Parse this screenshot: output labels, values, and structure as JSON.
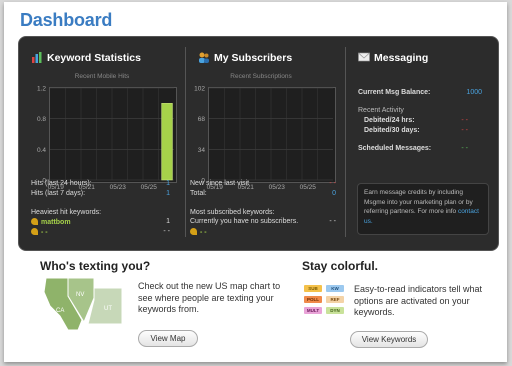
{
  "page": {
    "title": "Dashboard"
  },
  "keyword_stats": {
    "title": "Keyword Statistics",
    "chart_title": "Recent Mobile Hits",
    "rows": [
      {
        "label": "Hits (last 24 hours):",
        "value": "1"
      },
      {
        "label": "Hits (last 7 days):",
        "value": "1"
      }
    ],
    "heaviest_label": "Heaviest hit keywords:",
    "heaviest": [
      {
        "name": "mattbom",
        "value": "1"
      },
      {
        "name": "- -",
        "value": "- -"
      }
    ]
  },
  "subscribers": {
    "title": "My Subscribers",
    "chart_title": "Recent Subscriptions",
    "rows": [
      {
        "label": "New since last visit",
        "value": "- -"
      },
      {
        "label": "Total:",
        "value": "0"
      }
    ],
    "most_label": "Most subscribed keywords:",
    "most_text": "Currently you have no subscribers.",
    "most_value": "- -",
    "most_item": "- -"
  },
  "messaging": {
    "title": "Messaging",
    "balance_label": "Current Msg Balance:",
    "balance_value": "1000",
    "recent_label": "Recent Activity",
    "debited_24": "Debited/24 hrs:",
    "debited_24_val": "- -",
    "debited_30": "Debited/30 days:",
    "debited_30_val": "- -",
    "scheduled_label": "Scheduled Messages:",
    "scheduled_value": "- -",
    "info_text": "Earn message credits by including Msgme into your marketing plan or by referring partners. For more info",
    "info_link": "contact us."
  },
  "texting": {
    "title": "Who's texting you?",
    "text": "Check out the new US map chart to see where people are texting your keywords from.",
    "button": "View Map",
    "map_labels": [
      "NV",
      "CA",
      "UT"
    ]
  },
  "colorful": {
    "title": "Stay colorful.",
    "text": "Easy-to-read indicators tell what options are activated on your keywords.",
    "button": "View Keywords",
    "tags": [
      "SUB",
      "KW",
      "POLL",
      "REF",
      "MULT",
      "DYN"
    ]
  },
  "chart_data": [
    {
      "type": "bar",
      "title": "Recent Mobile Hits",
      "categories": [
        "05/19",
        "05/21",
        "05/23",
        "05/25"
      ],
      "values": [
        0,
        0,
        0,
        1
      ],
      "ylim": [
        0,
        1.2
      ],
      "yticks": [
        "1.2",
        "0.8",
        "0.4",
        "0"
      ]
    },
    {
      "type": "bar",
      "title": "Recent Subscriptions",
      "categories": [
        "05/19",
        "05/21",
        "05/23",
        "05/25"
      ],
      "values": [
        0,
        0,
        0,
        0
      ],
      "ylim": [
        0,
        102
      ],
      "yticks": [
        "102",
        "68",
        "34",
        "0"
      ]
    }
  ],
  "colors": {
    "accent": "#3a7cc2",
    "panel": "#2c2c2c",
    "bar": "#a6d24a"
  }
}
